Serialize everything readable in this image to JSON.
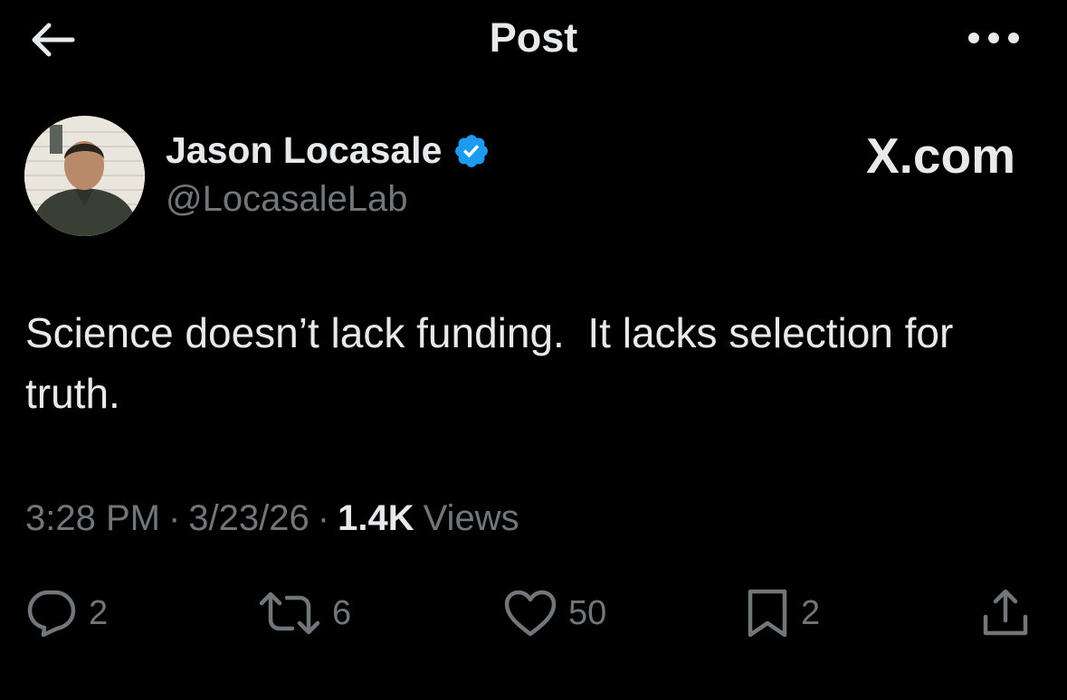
{
  "header": {
    "title": "Post",
    "back_icon": "arrow-left-icon",
    "more_icon": "more-horizontal-icon"
  },
  "author": {
    "name": "Jason Locasale",
    "handle": "@LocasaleLab",
    "verified": true,
    "verified_color": "#1d9bf0"
  },
  "watermark": "X.com",
  "post": {
    "text": "Science doesn’t lack funding.  It lacks selection for truth.",
    "time": "3:28 PM",
    "separator": "·",
    "date": "3/23/26",
    "views_count": "1.4K",
    "views_label": "Views"
  },
  "actions": {
    "replies": "2",
    "reposts": "6",
    "likes": "50",
    "bookmarks": "2"
  },
  "colors": {
    "background": "#000000",
    "text_primary": "#e7e9ea",
    "text_secondary": "#71767b"
  }
}
